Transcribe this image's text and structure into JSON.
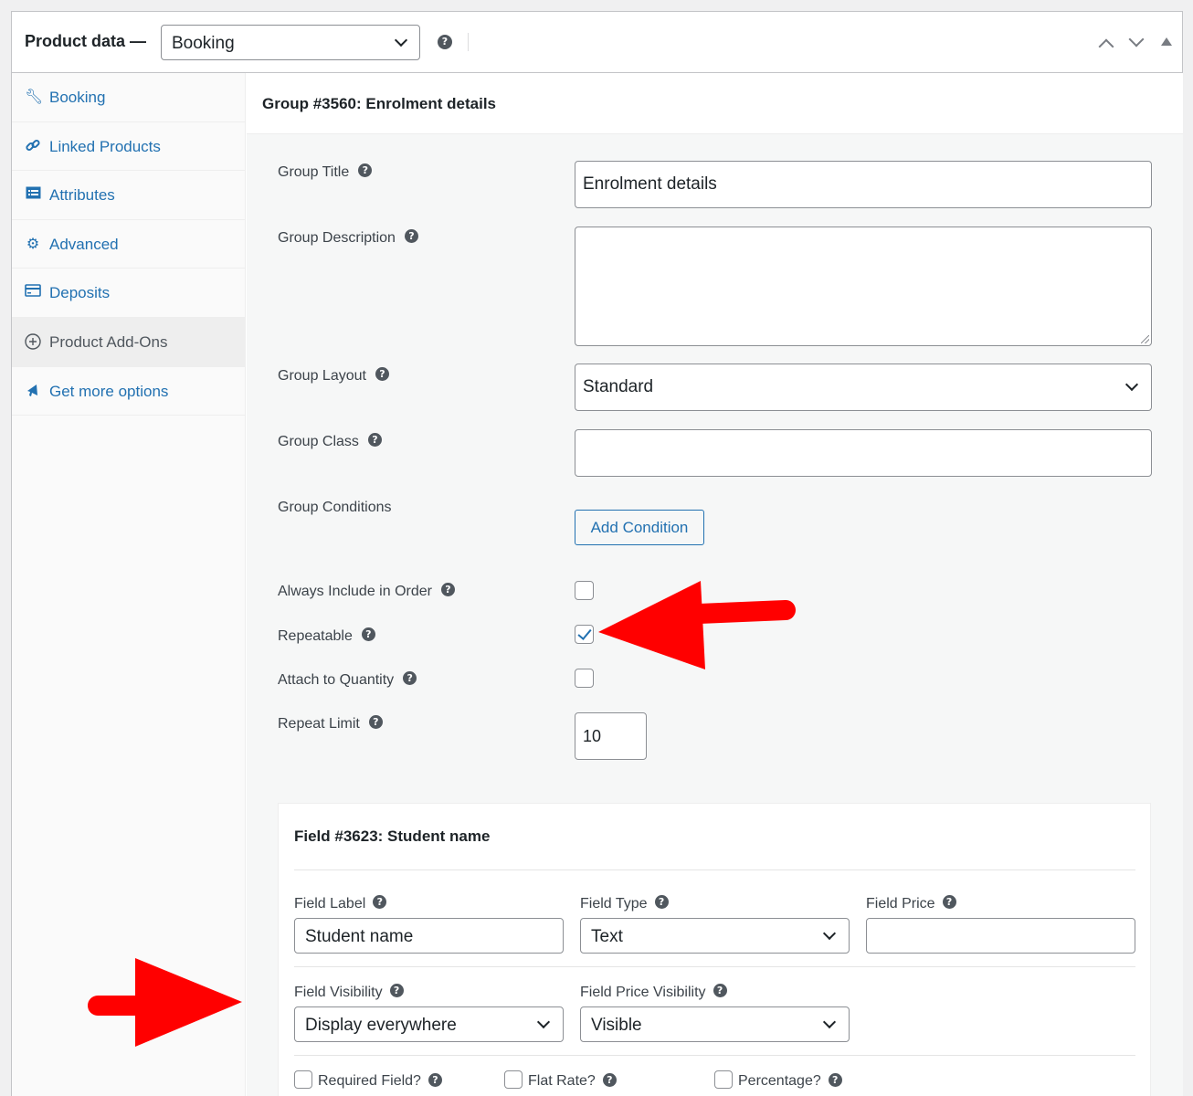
{
  "header": {
    "title": "Product data —",
    "product_type": "Booking",
    "help_glyph": "?"
  },
  "sidebar": {
    "items": [
      {
        "label": "Booking",
        "icon": "wrench-icon"
      },
      {
        "label": "Linked Products",
        "icon": "link-icon"
      },
      {
        "label": "Attributes",
        "icon": "list-icon"
      },
      {
        "label": "Advanced",
        "icon": "gear-icon"
      },
      {
        "label": "Deposits",
        "icon": "card-icon"
      },
      {
        "label": "Product Add-Ons",
        "icon": "plus-circle-icon",
        "active": true
      },
      {
        "label": "Get more options",
        "icon": "megaphone-icon"
      }
    ]
  },
  "group": {
    "heading": "Group #3560: Enrolment details",
    "title_label": "Group Title",
    "title_value": "Enrolment details",
    "description_label": "Group Description",
    "description_value": "",
    "layout_label": "Group Layout",
    "layout_value": "Standard",
    "class_label": "Group Class",
    "class_value": "",
    "conditions_label": "Group Conditions",
    "add_condition": "Add Condition",
    "always_include_label": "Always Include in Order",
    "always_include_checked": false,
    "repeatable_label": "Repeatable",
    "repeatable_checked": true,
    "attach_quantity_label": "Attach to Quantity",
    "attach_quantity_checked": false,
    "repeat_limit_label": "Repeat Limit",
    "repeat_limit_value": "10"
  },
  "field": {
    "heading": "Field #3623: Student name",
    "label_label": "Field Label",
    "label_value": "Student name",
    "type_label": "Field Type",
    "type_value": "Text",
    "price_label": "Field Price",
    "price_value": "",
    "visibility_label": "Field Visibility",
    "visibility_value": "Display everywhere",
    "price_visibility_label": "Field Price Visibility",
    "price_visibility_value": "Visible",
    "required_label": "Required Field?",
    "flat_rate_label": "Flat Rate?",
    "percentage_label": "Percentage?"
  },
  "colors": {
    "link": "#2271b1",
    "annotation_arrow": "#ff0000"
  }
}
